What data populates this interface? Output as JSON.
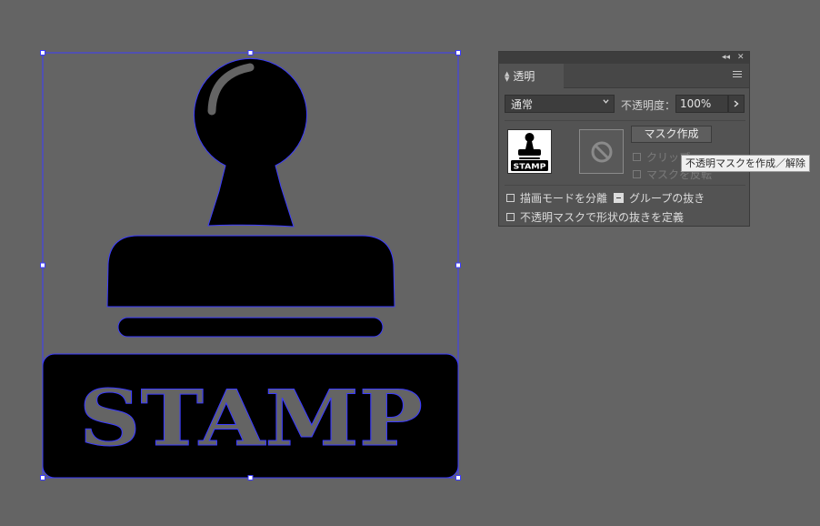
{
  "artboard": {
    "logo_text": "STAMP",
    "selection_color": "#3b3bff",
    "art_color": "#000000",
    "background_color": "#646464"
  },
  "panel": {
    "tab_label": "透明",
    "collapse_icon": "double-chevron-left-icon",
    "close_icon": "close-icon",
    "menu_icon": "hamburger-menu-icon",
    "blend_mode": "通常",
    "opacity_label": "不透明度：",
    "opacity_value": "100%",
    "make_mask_label": "マスク作成",
    "clip_label": "クリップ",
    "invert_mask_label": "マスクを反転",
    "isolate_blending_label": "描画モードを分離",
    "knockout_group_label": "グループの抜き",
    "opacity_mask_knockout_label": "不透明マスクで形状の抜きを定義",
    "thumbnail_text": "STAMP"
  },
  "tooltip": {
    "text": "不透明マスクを作成／解除"
  }
}
